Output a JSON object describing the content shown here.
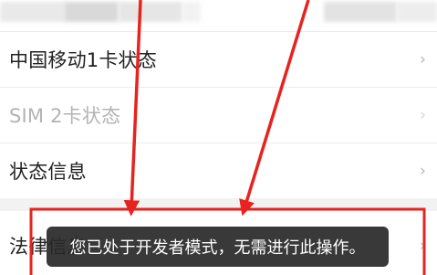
{
  "settings_list": {
    "items": [
      {
        "label": "中国移动1卡状态",
        "enabled": true
      },
      {
        "label": "SIM 2卡状态",
        "enabled": false
      },
      {
        "label": "状态信息",
        "enabled": true
      },
      {
        "label": "法律信息",
        "enabled": true
      }
    ],
    "chevron_glyph": "›"
  },
  "toast": {
    "message": "您已处于开发者模式，无需进行此操作。"
  },
  "colors": {
    "annotation_red": "#e8231f",
    "toast_background": "#282828",
    "disabled_text": "#b3b3b3"
  }
}
